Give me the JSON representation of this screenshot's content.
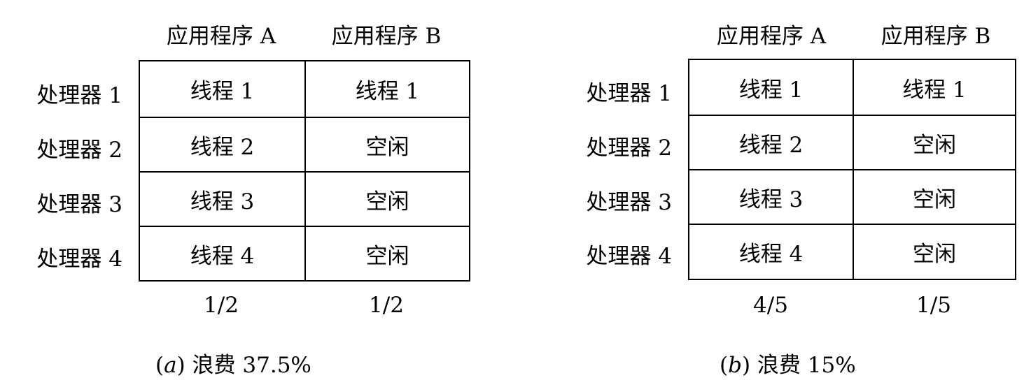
{
  "panels": [
    {
      "columns": [
        "应用程序 A",
        "应用程序 B"
      ],
      "rows": [
        {
          "processor": "处理器 1",
          "app_a": "线程 1",
          "app_b": "线程 1"
        },
        {
          "processor": "处理器 2",
          "app_a": "线程 2",
          "app_b": "空闲"
        },
        {
          "processor": "处理器 3",
          "app_a": "线程 3",
          "app_b": "空闲"
        },
        {
          "processor": "处理器 4",
          "app_a": "线程 4",
          "app_b": "空闲"
        }
      ],
      "fractions": [
        "1/2",
        "1/2"
      ],
      "caption": {
        "open": "(",
        "tag": "a",
        "close": ")",
        "text": " 浪费 37.5%"
      }
    },
    {
      "columns": [
        "应用程序 A",
        "应用程序 B"
      ],
      "rows": [
        {
          "processor": "处理器 1",
          "app_a": "线程 1",
          "app_b": "线程 1"
        },
        {
          "processor": "处理器 2",
          "app_a": "线程 2",
          "app_b": "空闲"
        },
        {
          "processor": "处理器 3",
          "app_a": "线程 3",
          "app_b": "空闲"
        },
        {
          "processor": "处理器 4",
          "app_a": "线程 4",
          "app_b": "空闲"
        }
      ],
      "fractions": [
        "4/5",
        "1/5"
      ],
      "caption": {
        "open": "(",
        "tag": "b",
        "close": ")",
        "text": " 浪费 15%"
      }
    }
  ]
}
